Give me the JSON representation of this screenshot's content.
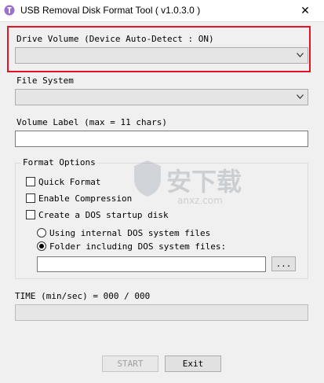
{
  "window": {
    "title": "USB Removal Disk Format Tool ( v1.0.3.0 )",
    "close_glyph": "✕"
  },
  "drive": {
    "label": "Drive Volume  (Device Auto-Detect : ON)",
    "value": ""
  },
  "filesystem": {
    "label": "File System",
    "value": ""
  },
  "volume": {
    "label": "Volume Label (max = 11 chars)",
    "value": ""
  },
  "format_options": {
    "title": "Format Options",
    "quick_format": "Quick Format",
    "enable_compression": "Enable Compression",
    "dos_startup": "Create a DOS startup disk",
    "internal_dos": "Using internal DOS system files",
    "folder_dos": "Folder including DOS system files:",
    "folder_path": "",
    "browse_label": "..."
  },
  "time": {
    "label": "TIME (min/sec) = 000 / 000",
    "progress": 0
  },
  "buttons": {
    "start": "START",
    "exit": "Exit"
  },
  "colors": {
    "highlight_border": "#e81123",
    "app_icon": "#9b6fd0"
  },
  "watermark": {
    "text": "安下载",
    "subtext": "anxz.com"
  }
}
